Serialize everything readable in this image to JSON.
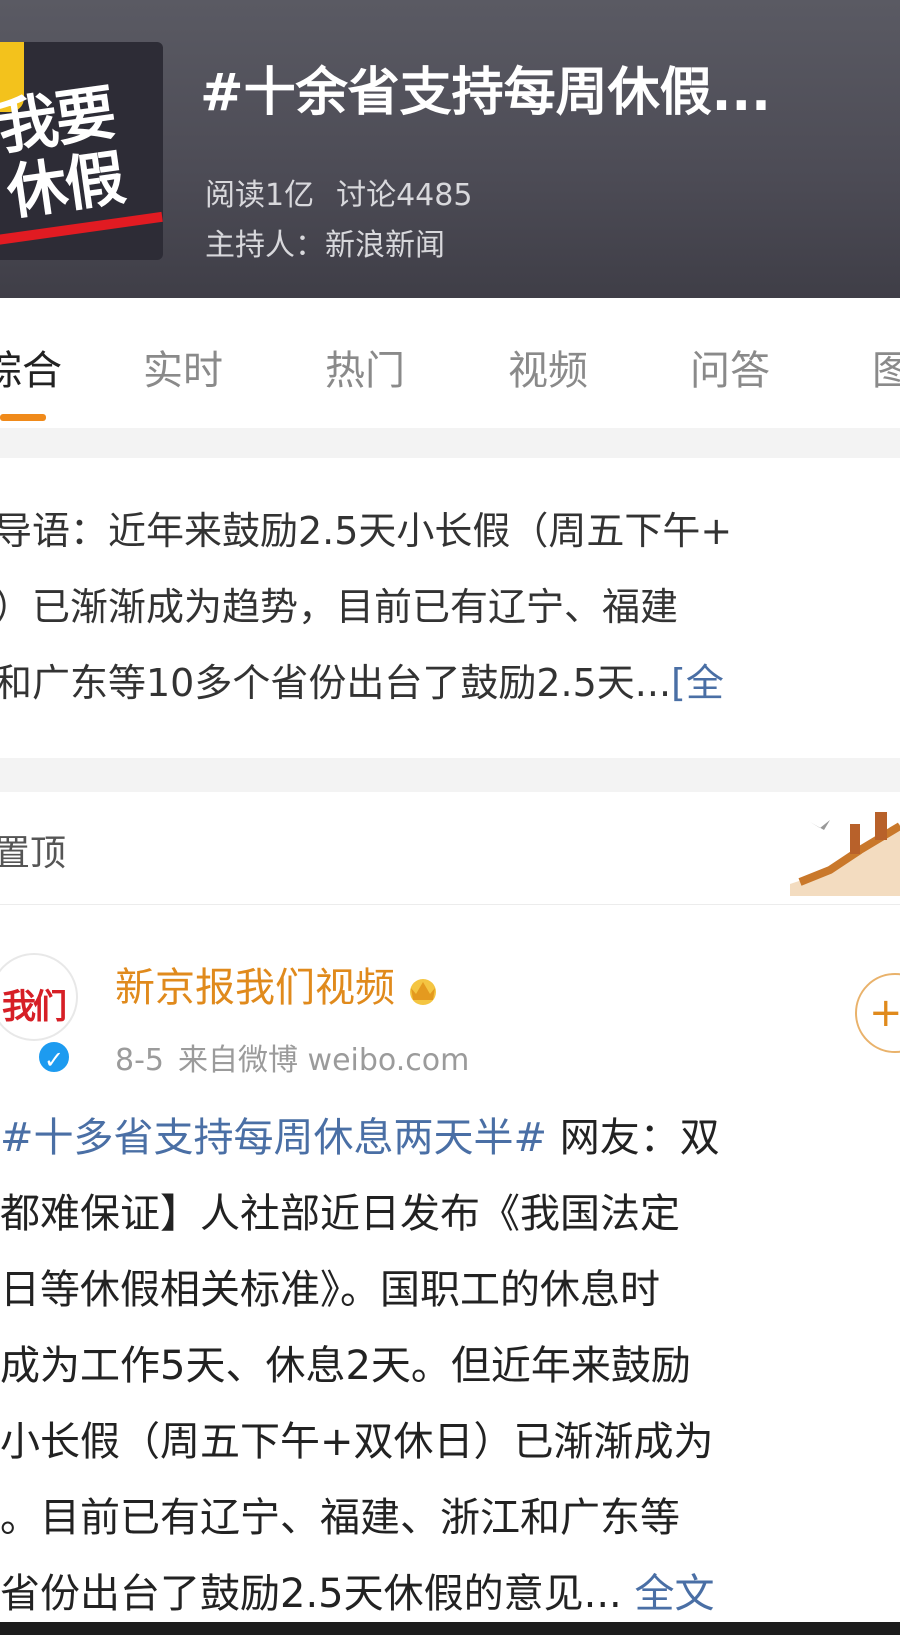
{
  "header": {
    "cover_text": [
      "我要",
      "休假"
    ],
    "title": "#十余省支持每周休假...",
    "reads": "阅读1亿",
    "discussions": "讨论4485",
    "host": "主持人：新浪新闻"
  },
  "tabs": [
    {
      "label": "综合",
      "active": true
    },
    {
      "label": "实时",
      "active": false
    },
    {
      "label": "热门",
      "active": false
    },
    {
      "label": "视频",
      "active": false
    },
    {
      "label": "问答",
      "active": false
    },
    {
      "label": "图",
      "active": false
    }
  ],
  "lead": {
    "line1": "导语：近年来鼓励2.5天小长假（周五下午+",
    "line2": "）已渐渐成为趋势，目前已有辽宁、福建",
    "line3": "和广东等10多个省份出台了鼓励2.5天...",
    "more": "[全"
  },
  "pinned": {
    "label": "置顶"
  },
  "post": {
    "avatar_text": "我们",
    "author": "新京报我们视频",
    "date": "8-5",
    "source": "来自微博 weibo.com",
    "follow": "+",
    "hashtag": "#十多省支持每周休息两天半#",
    "line1_rest": " 网友：双",
    "line2": "都难保证】人社部近日发布《我国法定",
    "line3": "日等休假相关标准》。国职工的休息时",
    "line4": "成为工作5天、休息2天。但近年来鼓励",
    "line5": "小长假（周五下午+双休日）已渐渐成为",
    "line6": "。目前已有辽宁、福建、浙江和广东等",
    "line7": "省份出台了鼓励2.5天休假的意见...",
    "expand": "全文"
  },
  "colors": {
    "accent": "#f08a1a",
    "link": "#4a6fa5",
    "author": "#e08a1c",
    "header_bg": "#4c4b55"
  }
}
